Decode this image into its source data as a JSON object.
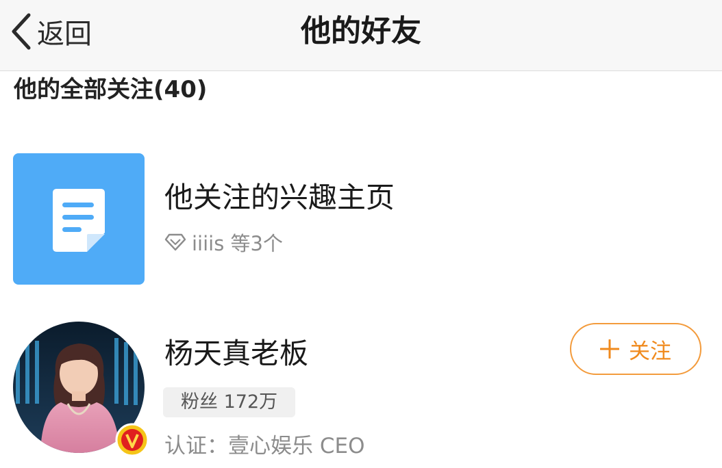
{
  "nav": {
    "back_label": "返回",
    "title": "他的好友"
  },
  "section": {
    "title": "他的全部关注(40)"
  },
  "interest": {
    "title": "他关注的兴趣主页",
    "subtitle": "iiiis 等3个",
    "tile_color": "#4fabf7"
  },
  "user": {
    "name": "杨天真老板",
    "fans": "粉丝 172万",
    "verification": "认证：壹心娱乐 CEO",
    "follow_label": "关注",
    "follow_color": "#f08a1d",
    "badge_icon": "verified-v-icon"
  }
}
